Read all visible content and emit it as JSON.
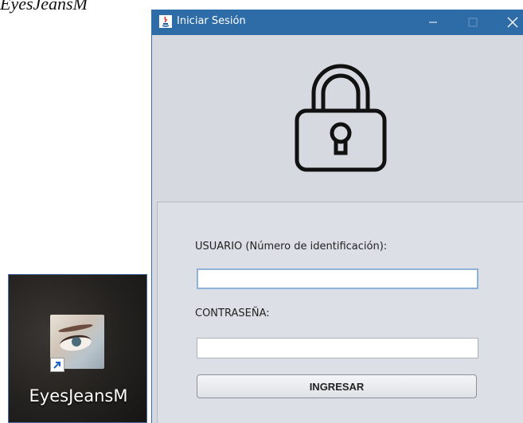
{
  "desktop": {
    "caption_top": "EyesJeansM",
    "shortcut": {
      "label": "EyesJeansM",
      "icon": "eyes-jeans-app-icon",
      "overlay_icon": "shortcut-arrow-icon"
    }
  },
  "window": {
    "title": "Iniciar Sesión",
    "title_icon": "java-icon",
    "controls": {
      "minimize": "—",
      "maximize": "☐",
      "close": "✕"
    },
    "lock_icon": "padlock-icon",
    "form": {
      "user_label": "USUARIO (Número de identificación):",
      "user_value": "",
      "pass_label": "CONTRASEÑA:",
      "pass_value": "",
      "submit_label": "INGRESAR"
    }
  },
  "colors": {
    "titlebar": "#2e6ca8",
    "window_bg": "#d6d9df",
    "focus_border": "#8fb2d8"
  }
}
